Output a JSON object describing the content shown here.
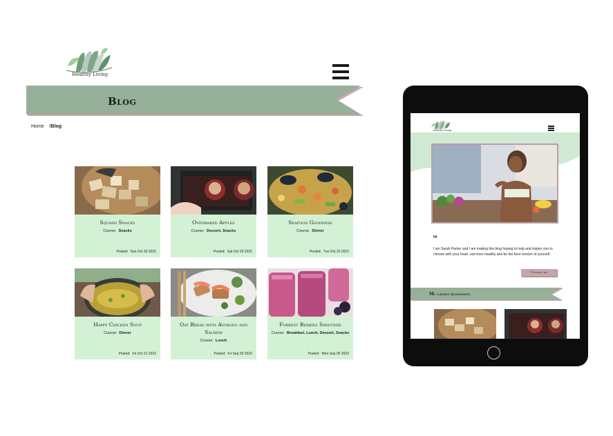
{
  "site": {
    "logo_text": "Healthy Living"
  },
  "desktop": {
    "page_title": "Blog",
    "breadcrumb": {
      "home": "Home",
      "current": "/Blog"
    },
    "course_label": "Course:",
    "posted_label": "Posted:",
    "cards": [
      {
        "title": "Squash Snacks",
        "course": "Snacks",
        "posted": "Sun Oct 30 2022",
        "image": "squash-snacks-photo"
      },
      {
        "title": "Ovenbaked Apples",
        "course": "Dessert, Snacks",
        "posted": "Sat Oct 29 2022",
        "image": "ovenbaked-apples-photo"
      },
      {
        "title": "Seafood Goodness",
        "course": "Dinner",
        "posted": "Tue Oct 25 2022",
        "image": "seafood-photo"
      },
      {
        "title": "Happy Chicken Soup",
        "course": "Dinner",
        "posted": "Fri Oct 21 2022",
        "image": "chicken-soup-photo"
      },
      {
        "title": "Oat Bread with Avokado and Salmon",
        "course": "Lunch",
        "posted": "Fri Sep 30 2022",
        "image": "oat-bread-salmon-photo"
      },
      {
        "title": "Forrest Berries Smoothie",
        "course": "Breakfast, Lunch, Dessert, Snacks",
        "posted": "Mon Sep 05 2022",
        "image": "berries-smoothie-photo"
      }
    ]
  },
  "tablet": {
    "greeting": "Hi",
    "intro": "I am Sarah Parker and I am making this blog hoping to help and inspire you to choose with your heart, eat more healthy and be the best version of yourself.",
    "contact_button": "Contact me",
    "latest_title": "My latest blogposts"
  },
  "colors": {
    "banner_green": "#97b09a",
    "banner_shadow": "#c7a5a9",
    "card_bg": "#d3f2d5",
    "hero_bg": "#cfe9d2",
    "button_pink": "#c7a5a9",
    "device_black": "#0d0d0d"
  }
}
